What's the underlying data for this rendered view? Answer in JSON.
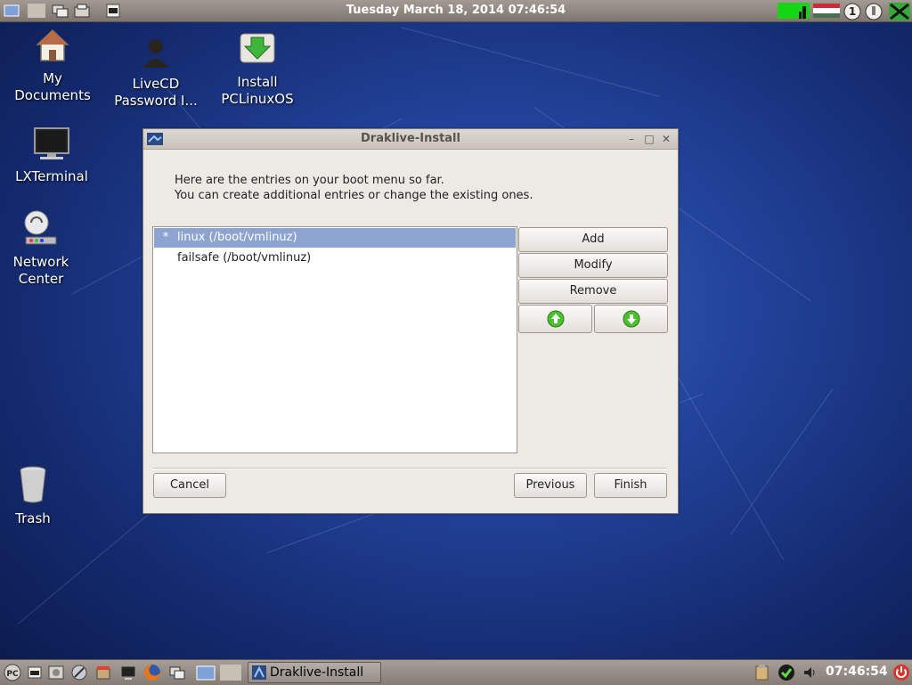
{
  "top_panel": {
    "datetime": "Tuesday March 18, 2014 07:46:54",
    "tray_icons": [
      "cpu-monitor-icon",
      "hungary-flag-icon",
      "workspace-1-icon",
      "network-status-icon",
      "xfree-icon"
    ]
  },
  "desktop": {
    "icons": [
      {
        "label": "My Documents",
        "icon": "home-folder-icon"
      },
      {
        "label": "LiveCD Password I...",
        "icon": "user-icon"
      },
      {
        "label": "Install PCLinuxOS",
        "icon": "install-icon"
      },
      {
        "label": "LXTerminal",
        "icon": "terminal-icon"
      },
      {
        "label": "Network Center",
        "icon": "network-center-icon"
      },
      {
        "label": "Trash",
        "icon": "trash-icon"
      }
    ]
  },
  "window": {
    "title": "Draklive-Install",
    "intro_line1": "Here are the entries on your boot menu so far.",
    "intro_line2": "You can create additional entries or change the existing ones.",
    "entries": [
      {
        "mark": "*",
        "label": "linux (/boot/vmlinuz)",
        "selected": true
      },
      {
        "mark": "",
        "label": "failsafe (/boot/vmlinuz)",
        "selected": false
      }
    ],
    "buttons": {
      "add": "Add",
      "modify": "Modify",
      "remove": "Remove",
      "cancel": "Cancel",
      "previous": "Previous",
      "finish": "Finish"
    }
  },
  "taskbar": {
    "task_label": "Draklive-Install",
    "clock": "07:46:54",
    "colors": {
      "accent": "#8da3d0",
      "panel": "#948b84"
    }
  }
}
